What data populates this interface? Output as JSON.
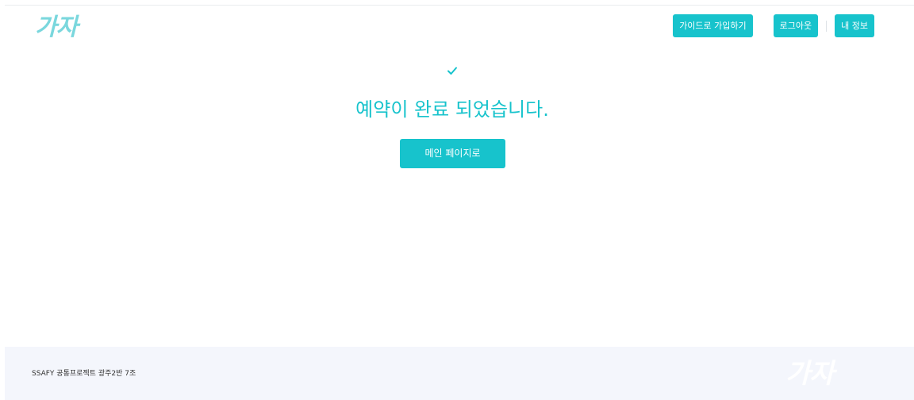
{
  "header": {
    "logo_text": "가자",
    "nav": {
      "guide_signup_label": "가이드로 가입하기",
      "logout_label": "로그아웃",
      "my_info_label": "내 정보"
    }
  },
  "main": {
    "icon": "check-icon",
    "message": "예약이 완료 되었습니다.",
    "main_page_button_label": "메인 페이지로"
  },
  "footer": {
    "text": "SSAFY 공통프로젝트 광주2반 7조",
    "logo_text": "가자"
  },
  "colors": {
    "accent": "#17c3cc",
    "logo": "#7ad7dd",
    "footer_bg": "#f4f6fc"
  }
}
